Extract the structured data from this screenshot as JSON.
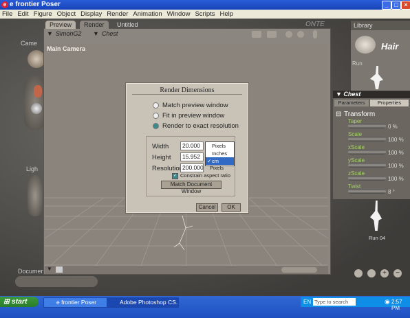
{
  "window": {
    "title": "e frontier Poser",
    "controls": [
      "_",
      "□",
      "×"
    ]
  },
  "menubar": [
    "File",
    "Edit",
    "Figure",
    "Object",
    "Display",
    "Render",
    "Animation",
    "Window",
    "Scripts",
    "Help"
  ],
  "left_labels": {
    "camera": "Came",
    "light": "Ligh",
    "document": "Document"
  },
  "preview": {
    "tabs": [
      "Preview",
      "Render",
      "Untitled"
    ],
    "figure": "SimonG2",
    "body_part": "Chest",
    "camera": "Main Camera",
    "watermark": "ONTE"
  },
  "dialog": {
    "title": "Render Dimensions",
    "options": [
      "Match preview window",
      "Fit in preview window",
      "Render to exact resolution"
    ],
    "selected_option": 2,
    "width_label": "Width",
    "width_value": "20.000",
    "height_label": "Height",
    "height_value": "15.952",
    "resolution_label": "Resolution",
    "resolution_value": "200.000",
    "resolution_unit": "Pixels",
    "constrain_label": "Constrain aspect ratio",
    "constrain_checked": true,
    "match_button": "Match Document Window",
    "cancel": "Cancel",
    "ok": "OK"
  },
  "units_dropdown": {
    "options": [
      "Pixels",
      "Inches",
      "cm"
    ],
    "selected": "cm"
  },
  "library": {
    "title": "Library",
    "category": "Hair",
    "item": "Run"
  },
  "params_panel": {
    "title": "Chest",
    "tabs": [
      "Parameters",
      "Properties"
    ],
    "section": "Transform",
    "rows": [
      {
        "name": "Taper",
        "value": "0 %"
      },
      {
        "name": "Scale",
        "value": "100 %"
      },
      {
        "name": "xScale",
        "value": "100 %"
      },
      {
        "name": "yScale",
        "value": "100 %"
      },
      {
        "name": "zScale",
        "value": "100 %"
      },
      {
        "name": "Twist",
        "value": "8 °"
      }
    ],
    "pose_label": "Run 04"
  },
  "taskbar": {
    "start": "start",
    "buttons": [
      "e frontier Poser",
      "Adobe Photoshop CS..."
    ],
    "lang": "EN",
    "search_placeholder": "Type to search",
    "time": "2:57 PM"
  }
}
